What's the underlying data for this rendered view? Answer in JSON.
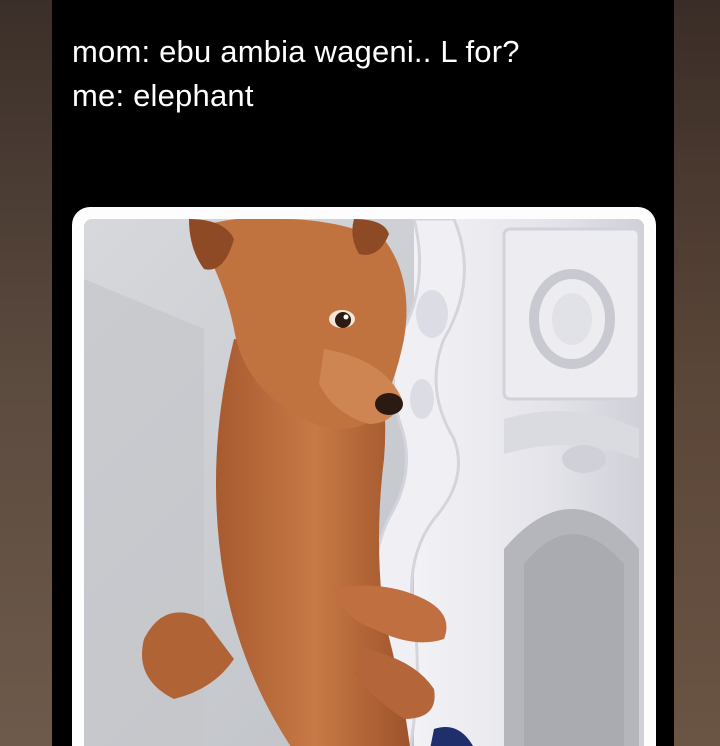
{
  "meme": {
    "caption_lines": [
      "mom: ebu ambia wageni.. L for?",
      "me: elephant"
    ]
  },
  "image": {
    "subject": "dog-hugging-furniture-leg"
  },
  "colors": {
    "post_background": "#000000",
    "caption_text": "#ffffff",
    "frame": "#fdfdfd",
    "dog_fur": "#b7683a",
    "furniture": "#e9e9ee"
  }
}
